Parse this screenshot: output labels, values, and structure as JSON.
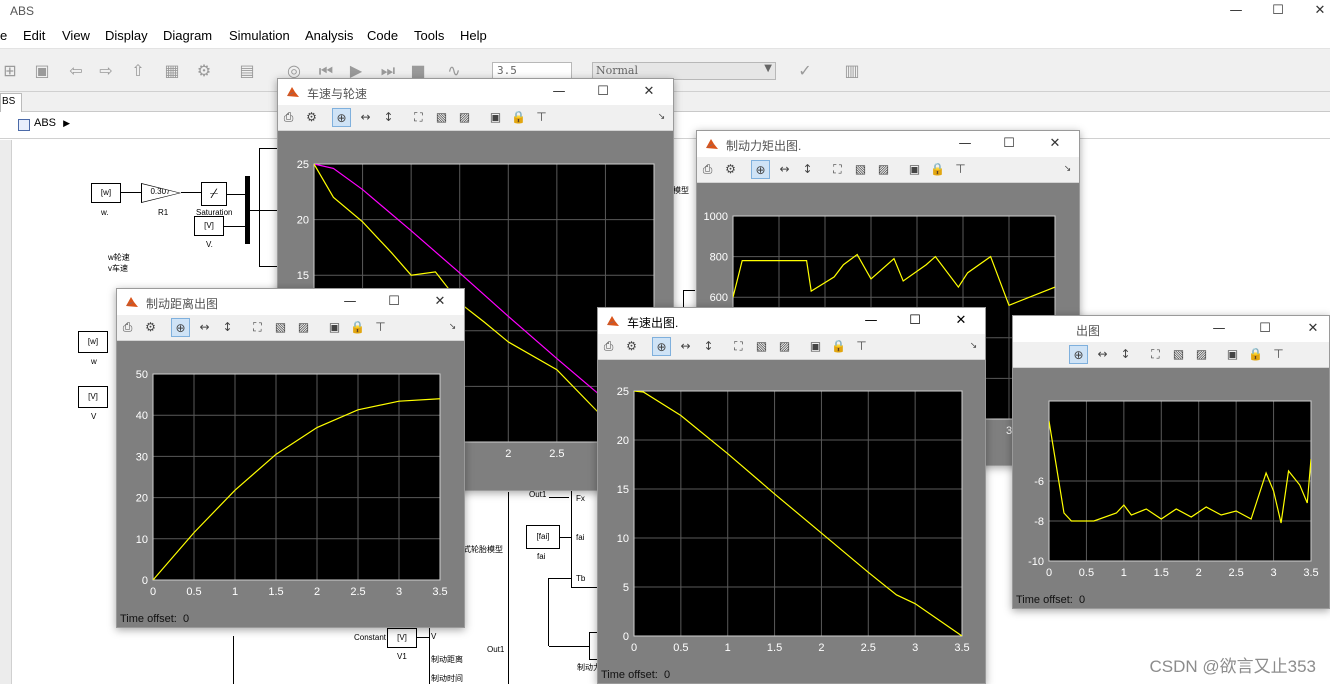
{
  "app": {
    "window_title": "ABS",
    "menu": [
      "e",
      "Edit",
      "View",
      "Display",
      "Diagram",
      "Simulation",
      "Analysis",
      "Code",
      "Tools",
      "Help"
    ],
    "stop_time": "3.5",
    "sim_mode": "Normal",
    "tab_label": "BS",
    "breadcrumb": "ABS"
  },
  "diagram": {
    "blocks": {
      "goto_w_top": "[w]",
      "goto_w_top_label": "w.",
      "gain_value": "0.307",
      "gain_label": "R1",
      "saturation_label": "Saturation",
      "goto_V_top": "[V]",
      "goto_V_top_label": "V.",
      "note_w": "w轮速",
      "note_v": "v车速",
      "goto_w_left": "[w]",
      "goto_w_left_label": "w",
      "goto_V_left": "[V]",
      "goto_V_left_label": "V",
      "out1_a": "Out1",
      "port_fx": "Fx",
      "port_fai": "fai",
      "port_tb": "Tb",
      "fai_tag": "[fai]",
      "fai_label": "fai",
      "tire_model_note": "式轮胎模型",
      "constant_label": "Constant",
      "v1_tag": "[V]",
      "v1_label": "V1",
      "port_v": "V",
      "port_dist": "制动距离",
      "port_time": "制动时间",
      "out1_b": "Out1",
      "zhidong_label": "制动力",
      "model_note": "模型"
    }
  },
  "scopes": [
    {
      "id": "wheel",
      "title": "车速与轮速",
      "offset_label": "",
      "xticks": [
        "2",
        "2.5"
      ],
      "yticks": [
        "25",
        "20",
        "15"
      ]
    },
    {
      "id": "torque",
      "title": "制动力矩出图.",
      "offset_label": "",
      "xticks": [
        "3",
        "3.5"
      ],
      "yticks": [
        "1000",
        "800",
        "600"
      ]
    },
    {
      "id": "dist",
      "title": "制动距离出图",
      "offset_label": "Time offset:",
      "offset_value": "0",
      "xticks": [
        "0",
        "0.5",
        "1",
        "1.5",
        "2",
        "2.5",
        "3",
        "3.5"
      ],
      "yticks": [
        "50",
        "40",
        "30",
        "20",
        "10",
        "0"
      ]
    },
    {
      "id": "speed",
      "title": "车速出图.",
      "offset_label": "Time offset:",
      "offset_value": "0",
      "xticks": [
        "0",
        "0.5",
        "1",
        "1.5",
        "2",
        "2.5",
        "3",
        "3.5"
      ],
      "yticks": [
        "25",
        "20",
        "15",
        "10",
        "5",
        "0"
      ]
    },
    {
      "id": "slip",
      "title": "出图",
      "offset_label": "Time offset:",
      "offset_value": "0",
      "xticks": [
        "0",
        "0.5",
        "1",
        "1.5",
        "2",
        "2.5",
        "3",
        "3.5"
      ],
      "yticks": [
        "-6",
        "-8",
        "-10"
      ]
    }
  ],
  "chart_data": [
    {
      "type": "line",
      "title": "车速与轮速",
      "xlim": [
        0,
        3.5
      ],
      "ylim": [
        0,
        25
      ],
      "series": [
        {
          "color": "#ff00ff",
          "x": [
            0,
            0.2,
            0.5,
            1.0,
            1.5,
            2.0,
            2.5,
            3.0
          ],
          "y": [
            25,
            24.6,
            22.7,
            19.0,
            15.2,
            11.3,
            7.5,
            3.8
          ]
        },
        {
          "color": "#ffff00",
          "x": [
            0,
            0.2,
            0.5,
            0.8,
            1.0,
            1.25,
            1.5,
            1.75,
            2.0,
            2.5,
            3.0
          ],
          "y": [
            25,
            22,
            19.8,
            17,
            15,
            15.3,
            12.5,
            10.8,
            9,
            6.5,
            2
          ]
        }
      ]
    },
    {
      "type": "line",
      "title": "制动力矩出图.",
      "xlim": [
        0,
        3.5
      ],
      "ylim": [
        0,
        1000
      ],
      "series": [
        {
          "color": "#ffff00",
          "x": [
            0,
            0.1,
            0.15,
            0.8,
            0.85,
            1.1,
            1.2,
            1.35,
            1.5,
            1.75,
            1.85,
            2.1,
            2.2,
            2.45,
            2.55,
            2.8,
            3.0,
            3.5
          ],
          "y": [
            600,
            780,
            780,
            780,
            630,
            700,
            760,
            810,
            690,
            790,
            680,
            760,
            800,
            650,
            720,
            800,
            560,
            650
          ]
        }
      ]
    },
    {
      "type": "line",
      "title": "制动距离出图",
      "xlim": [
        0,
        3.5
      ],
      "ylim": [
        0,
        50
      ],
      "series": [
        {
          "color": "#ffff00",
          "x": [
            0,
            0.5,
            1.0,
            1.5,
            2.0,
            2.5,
            3.0,
            3.5
          ],
          "y": [
            0,
            11.5,
            21.8,
            30.5,
            37,
            41.3,
            43.4,
            44
          ]
        }
      ]
    },
    {
      "type": "line",
      "title": "车速出图.",
      "xlim": [
        0,
        3.5
      ],
      "ylim": [
        0,
        25
      ],
      "series": [
        {
          "color": "#ffff00",
          "x": [
            0,
            0.1,
            0.5,
            1.0,
            1.5,
            2.0,
            2.5,
            2.8,
            3.0,
            3.5
          ],
          "y": [
            25,
            24.9,
            22.5,
            18.6,
            14.5,
            10.5,
            6.5,
            4.2,
            3.3,
            0
          ]
        }
      ]
    },
    {
      "type": "line",
      "title": "出图",
      "xlim": [
        0,
        3.5
      ],
      "ylim": [
        -10,
        -2
      ],
      "series": [
        {
          "color": "#ffff00",
          "x": [
            0,
            0.2,
            0.3,
            0.6,
            0.9,
            1.0,
            1.1,
            1.3,
            1.5,
            1.7,
            1.9,
            2.1,
            2.3,
            2.5,
            2.7,
            2.9,
            3.0,
            3.1,
            3.2,
            3.35,
            3.45,
            3.5
          ],
          "y": [
            -3,
            -7.6,
            -8.0,
            -8.0,
            -7.6,
            -7.2,
            -7.7,
            -7.4,
            -7.9,
            -7.4,
            -7.8,
            -7.3,
            -7.7,
            -7.5,
            -7.9,
            -5.6,
            -6.5,
            -8.1,
            -5.5,
            -6.2,
            -7.1,
            -4.9
          ]
        }
      ]
    }
  ],
  "watermark": "CSDN @欲言又止353"
}
